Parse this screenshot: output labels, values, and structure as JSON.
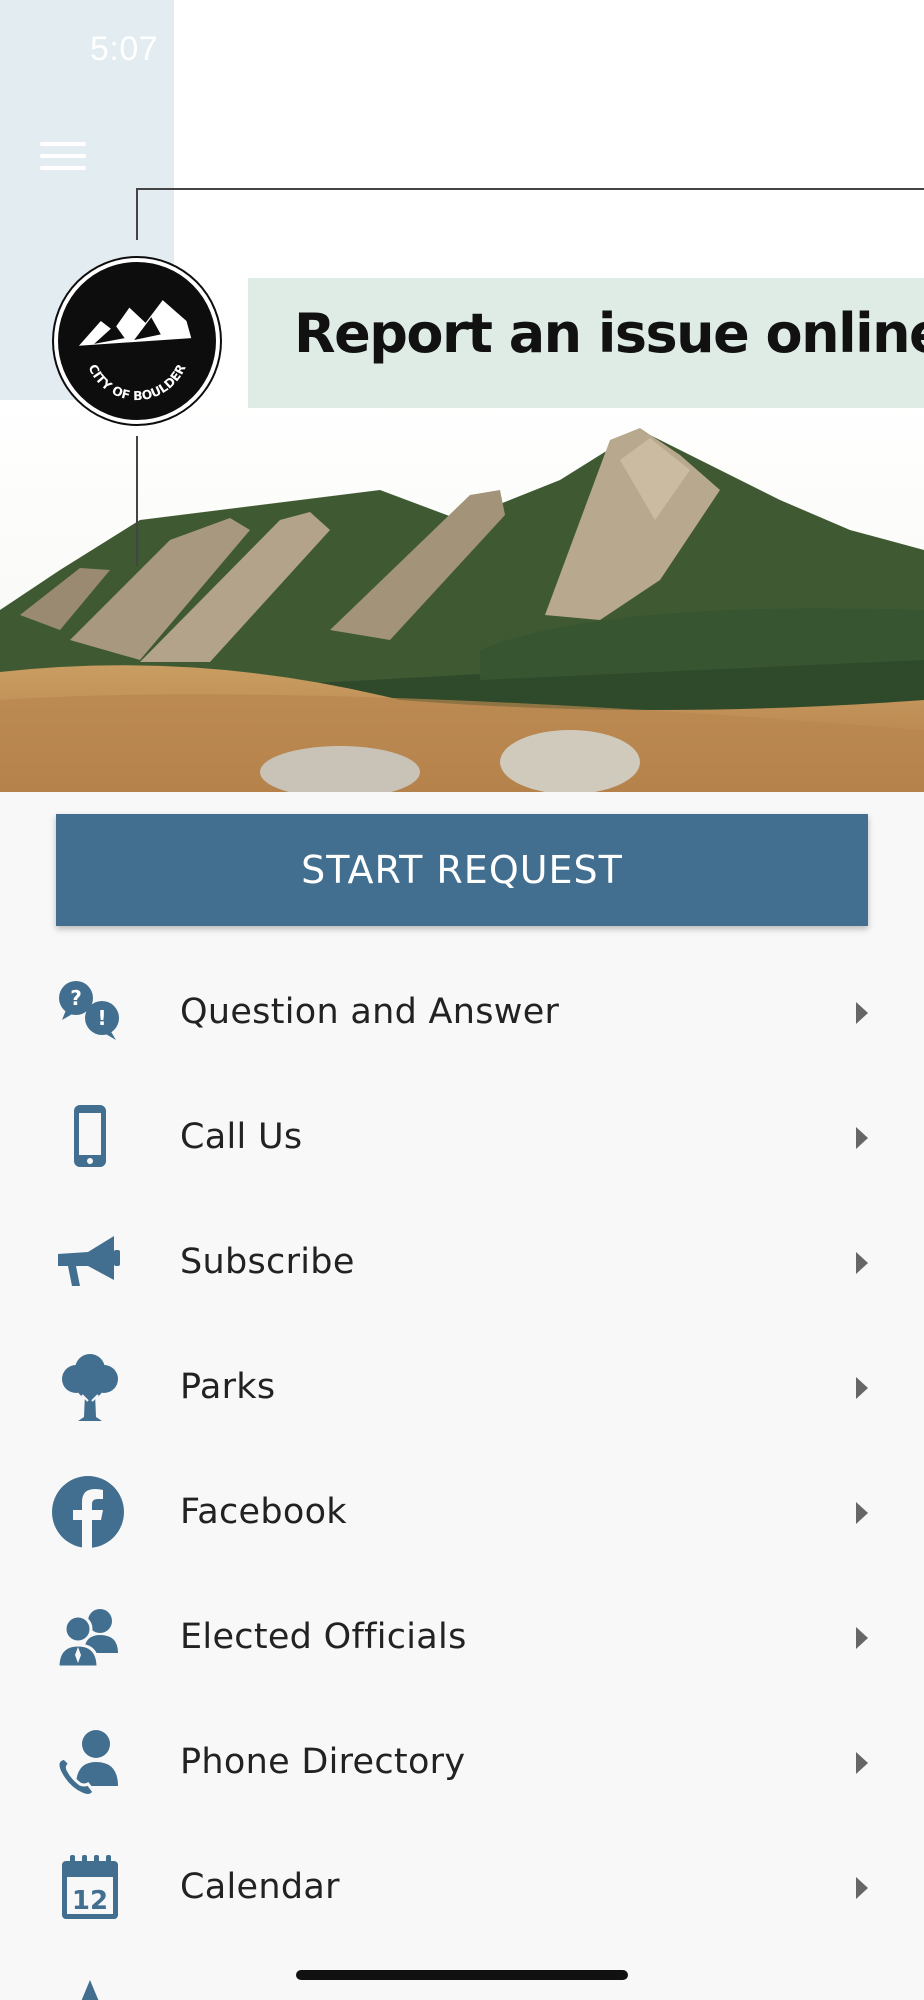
{
  "status_bar": {
    "time": "5:07"
  },
  "header": {
    "banner_text": "Report an issue online",
    "logo_text": "CITY OF BOULDER"
  },
  "start_button": {
    "label": "START REQUEST"
  },
  "menu": [
    {
      "label": "Question and Answer",
      "icon": "question-answer-icon"
    },
    {
      "label": "Call Us",
      "icon": "mobile-phone-icon"
    },
    {
      "label": "Subscribe",
      "icon": "megaphone-icon"
    },
    {
      "label": "Parks",
      "icon": "tree-icon"
    },
    {
      "label": "Facebook",
      "icon": "facebook-icon"
    },
    {
      "label": "Elected Officials",
      "icon": "officials-icon"
    },
    {
      "label": "Phone Directory",
      "icon": "phone-directory-icon"
    },
    {
      "label": "Calendar",
      "icon": "calendar-icon"
    }
  ],
  "calendar_icon_day": "12",
  "colors": {
    "accent": "#426f8f",
    "banner_bg": "#dfece5",
    "side_strip": "#e3ecf1"
  }
}
